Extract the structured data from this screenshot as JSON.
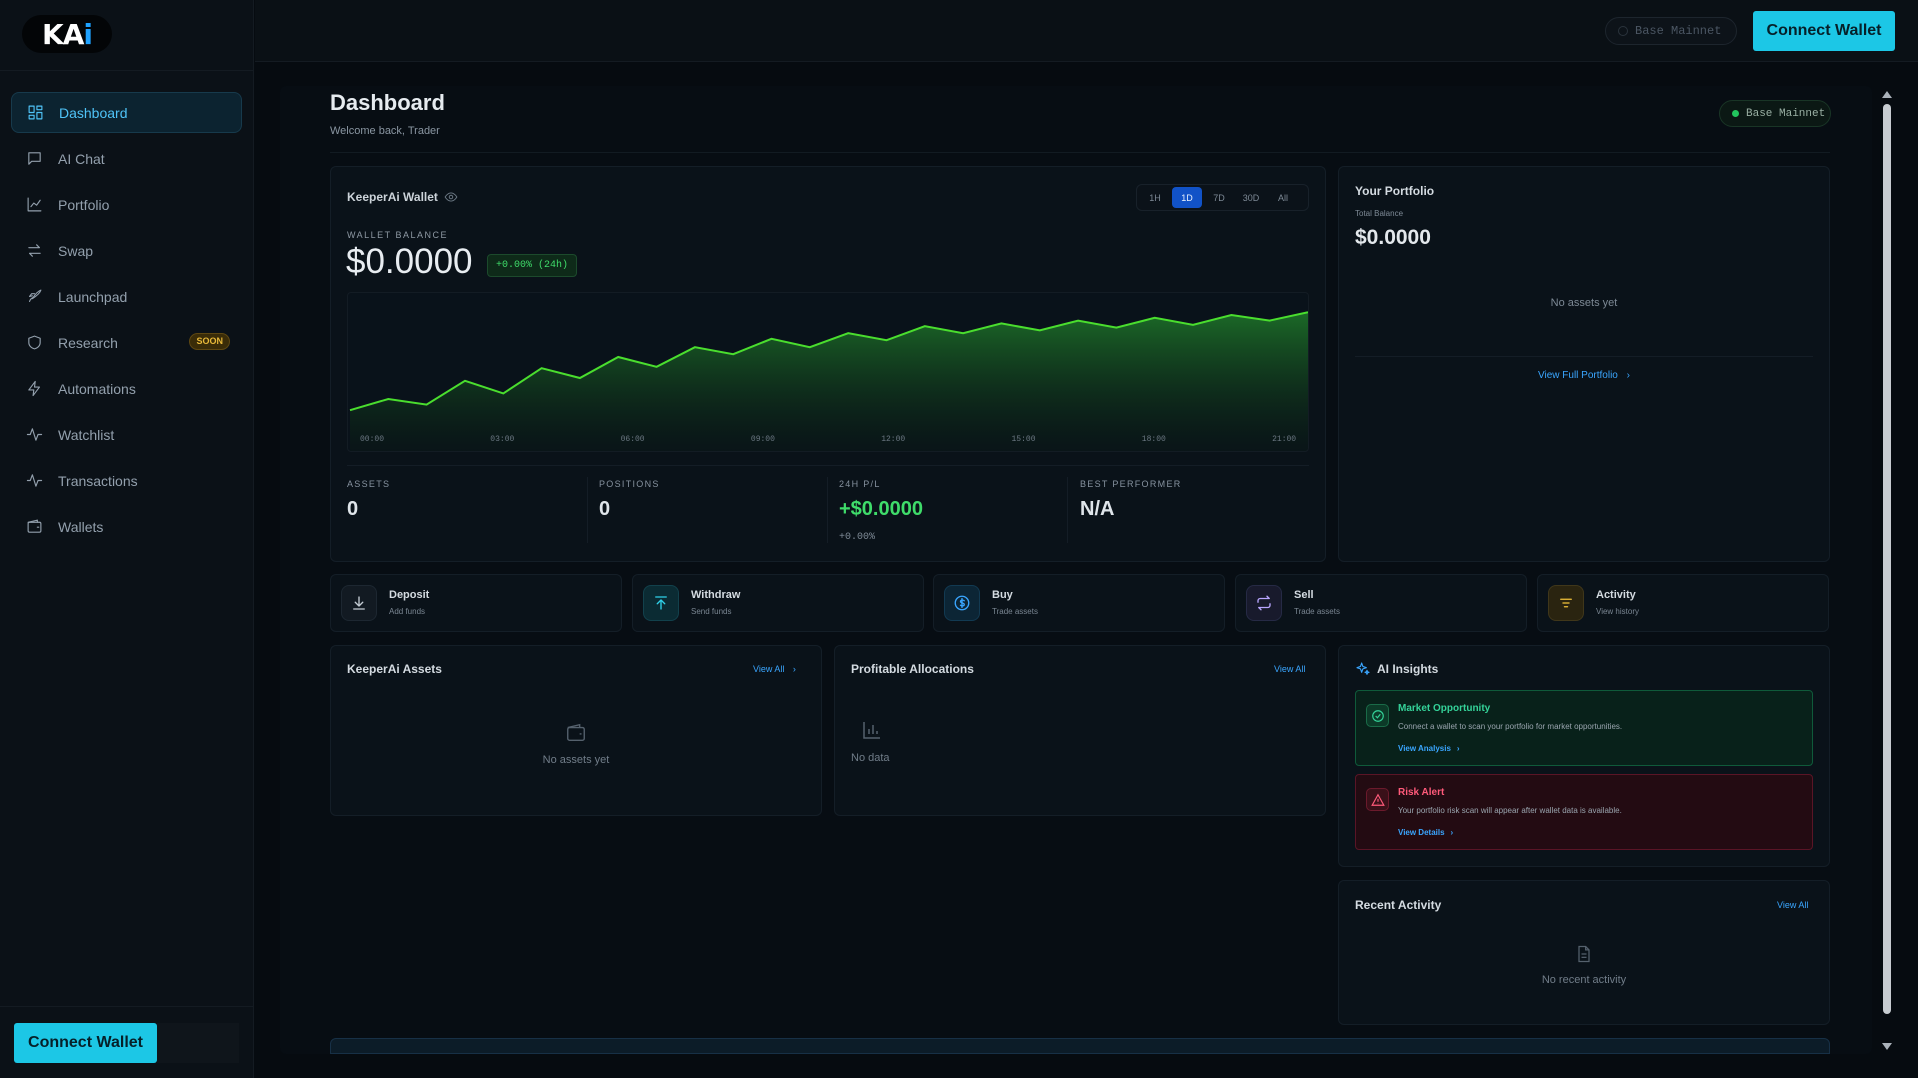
{
  "app": {
    "logo": "KAi"
  },
  "sidebar": {
    "items": [
      {
        "label": "Dashboard",
        "icon": "dashboard-icon",
        "active": true
      },
      {
        "label": "AI Chat",
        "icon": "chat-icon"
      },
      {
        "label": "Portfolio",
        "icon": "line-chart-icon"
      },
      {
        "label": "Swap",
        "icon": "swap-icon"
      },
      {
        "label": "Launchpad",
        "icon": "rocket-icon"
      },
      {
        "label": "Research",
        "icon": "shield-icon",
        "badge": "SOON"
      },
      {
        "label": "Automations",
        "icon": "bolt-icon"
      },
      {
        "label": "Watchlist",
        "icon": "pulse-icon"
      },
      {
        "label": "Transactions",
        "icon": "activity-icon"
      },
      {
        "label": "Wallets",
        "icon": "wallet-icon"
      }
    ],
    "connect_label": "Connect Wallet"
  },
  "topbar": {
    "network": "Base Mainnet",
    "connect_label": "Connect Wallet"
  },
  "page": {
    "title": "Dashboard",
    "subtitle": "Welcome back, Trader",
    "network_badge": "Base Mainnet"
  },
  "wallet": {
    "name": "KeeperAi Wallet",
    "timeframes": [
      "1H",
      "1D",
      "7D",
      "30D",
      "All"
    ],
    "active_timeframe": "1D",
    "balance_label": "WALLET BALANCE",
    "balance": "$0.0000",
    "change": "+0.00% (24h)",
    "stats": {
      "assets_label": "ASSETS",
      "assets": "0",
      "positions_label": "POSITIONS",
      "positions": "0",
      "pl_label": "24H P/L",
      "pl": "+$0.0000",
      "pl_pct": "+0.00%",
      "best_label": "BEST PERFORMER",
      "best": "N/A"
    }
  },
  "chart_data": {
    "type": "area",
    "x": [
      "00:00",
      "03:00",
      "06:00",
      "09:00",
      "12:00",
      "15:00",
      "18:00",
      "21:00"
    ],
    "series": [
      {
        "values": [
          2,
          10,
          6,
          23,
          14,
          32,
          25,
          40,
          33,
          47,
          42,
          53,
          47,
          57,
          52,
          62,
          57,
          64,
          59,
          66,
          61,
          68,
          63,
          70,
          66,
          72
        ]
      }
    ],
    "ylim": [
      0,
      80
    ],
    "color": "#4ade2e",
    "grid": false
  },
  "portfolio": {
    "title": "Your Portfolio",
    "total_label": "Total Balance",
    "total": "$0.0000",
    "empty": "No assets yet",
    "link": "View Full Portfolio"
  },
  "actions": [
    {
      "title": "Deposit",
      "sub": "Add funds",
      "icon": "download-icon",
      "color": "#c4ccd4",
      "bg": "#121a22"
    },
    {
      "title": "Withdraw",
      "sub": "Send funds",
      "icon": "upload-icon",
      "color": "#2fd1e9",
      "bg": "#0b2b33"
    },
    {
      "title": "Buy",
      "sub": "Trade assets",
      "icon": "dollar-coin-icon",
      "color": "#3aa6ff",
      "bg": "#0c2535"
    },
    {
      "title": "Sell",
      "sub": "Trade assets",
      "icon": "repeat-icon",
      "color": "#b9a6ff",
      "bg": "#181a2c"
    },
    {
      "title": "Activity",
      "sub": "View history",
      "icon": "filter-lines-icon",
      "color": "#f2c23a",
      "bg": "#2a2410"
    }
  ],
  "assets_card": {
    "title": "KeeperAi Assets",
    "link": "View All",
    "empty": "No assets yet"
  },
  "alloc_card": {
    "title": "Profitable Allocations",
    "link": "View All",
    "empty": "No data"
  },
  "ai_insights": {
    "title": "AI Insights",
    "items": [
      {
        "title": "Market Opportunity",
        "desc": "Connect a wallet to scan your portfolio for market opportunities.",
        "link": "View Analysis",
        "color": "#34d399"
      },
      {
        "title": "Risk Alert",
        "desc": "Your portfolio risk scan will appear after wallet data is available.",
        "link": "View Details",
        "color": "#ff5a7a"
      }
    ]
  },
  "recent_activity": {
    "title": "Recent Activity",
    "link": "View All",
    "empty": "No recent activity"
  }
}
